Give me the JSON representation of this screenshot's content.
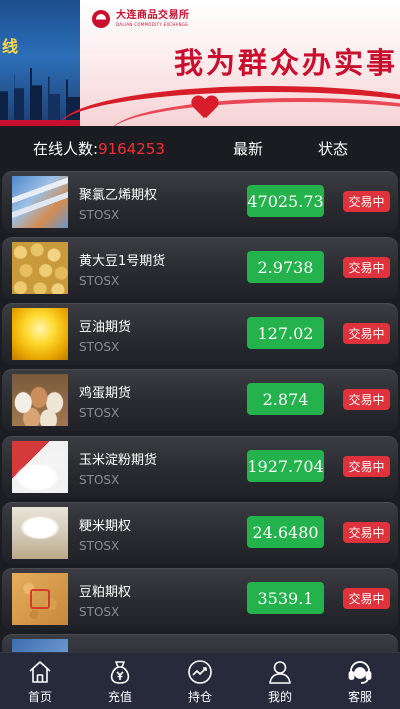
{
  "banner": {
    "left_text": "线",
    "logo_cn": "大连商品交易所",
    "logo_en": "DALIAN COMMODITY EXCHANGE",
    "title": "我为群众办实事"
  },
  "header": {
    "online_label": "在线人数:",
    "online_count": "9164253",
    "latest_label": "最新",
    "status_label": "状态"
  },
  "products": [
    {
      "name": "聚氯乙烯期权",
      "code": "STOSX",
      "price": "47025.73",
      "status": "交易中",
      "thumb": "pvc-pipes"
    },
    {
      "name": "黄大豆1号期货",
      "code": "STOSX",
      "price": "2.9738",
      "status": "交易中",
      "thumb": "soybeans"
    },
    {
      "name": "豆油期货",
      "code": "STOSX",
      "price": "127.02",
      "status": "交易中",
      "thumb": "soybean-oil"
    },
    {
      "name": "鸡蛋期货",
      "code": "STOSX",
      "price": "2.874",
      "status": "交易中",
      "thumb": "eggs"
    },
    {
      "name": "玉米淀粉期货",
      "code": "STOSX",
      "price": "1927.704",
      "status": "交易中",
      "thumb": "corn-starch"
    },
    {
      "name": "粳米期权",
      "code": "STOSX",
      "price": "24.6480",
      "status": "交易中",
      "thumb": "rice"
    },
    {
      "name": "豆粕期权",
      "code": "STOSX",
      "price": "3539.1",
      "status": "交易中",
      "thumb": "soybean-meal"
    }
  ],
  "nav": [
    {
      "label": "首页",
      "icon": "home-icon"
    },
    {
      "label": "充值",
      "icon": "money-bag-icon"
    },
    {
      "label": "持仓",
      "icon": "chart-trend-icon"
    },
    {
      "label": "我的",
      "icon": "user-icon"
    },
    {
      "label": "客服",
      "icon": "headset-icon"
    }
  ],
  "colors": {
    "price_bg": "#23b24b",
    "status_bg": "#e0323d",
    "online_count": "#ff2b2b",
    "nav_bg": "#262a3b"
  }
}
